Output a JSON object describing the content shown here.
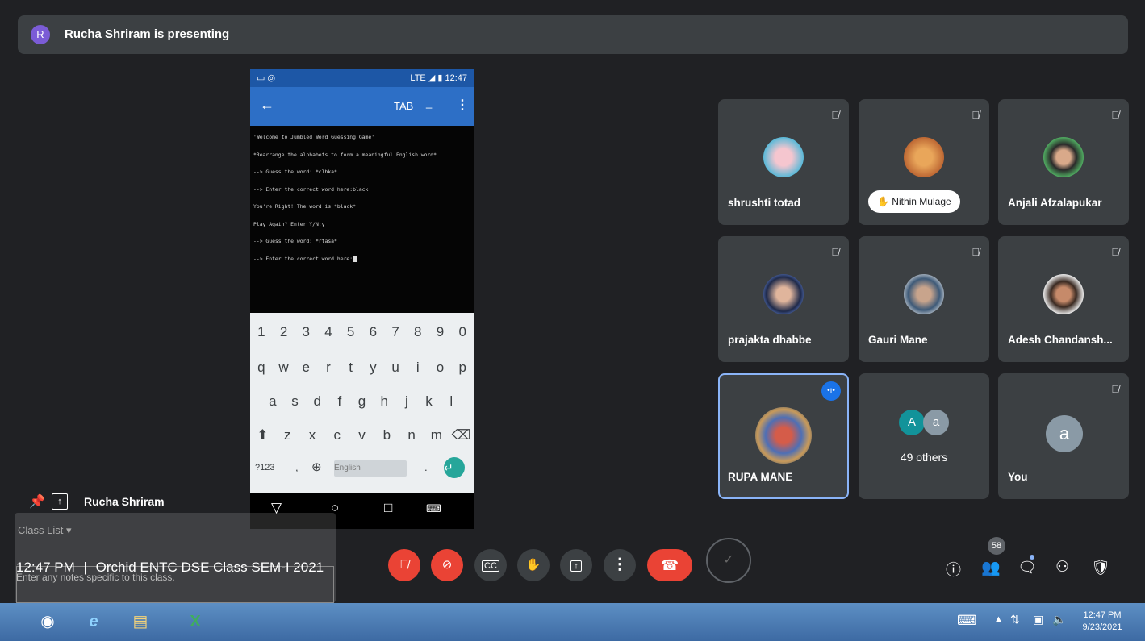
{
  "banner": {
    "avatar_letter": "R",
    "text": "Rucha Shriram is presenting"
  },
  "phone": {
    "status_time": "12:47",
    "status_network": "LTE",
    "appbar_title": "TAB",
    "terminal_lines": [
      "'Welcome to Jumbled Word Guessing Game'",
      "*Rearrange the alphabets to form a meaningful English word*",
      "--> Guess the word: *clbka*",
      "--> Enter the correct word here:black",
      "You're Right! The word is *black*",
      "Play Again? Enter Y/N:y",
      "--> Guess the word: *rtasa*",
      "--> Enter the correct word here:"
    ],
    "keyboard": {
      "row1": [
        "1",
        "2",
        "3",
        "4",
        "5",
        "6",
        "7",
        "8",
        "9",
        "0"
      ],
      "row2": [
        "q",
        "w",
        "e",
        "r",
        "t",
        "y",
        "u",
        "i",
        "o",
        "p"
      ],
      "row3": [
        "a",
        "s",
        "d",
        "f",
        "g",
        "h",
        "j",
        "k",
        "l"
      ],
      "row4": [
        "z",
        "x",
        "c",
        "v",
        "b",
        "n",
        "m"
      ],
      "sym_key": "?123",
      "comma": ",",
      "period": ".",
      "space_label": "English"
    }
  },
  "participants": [
    {
      "name": "shrushti totad",
      "muted": true
    },
    {
      "name": "Nithin Mulage",
      "muted": true,
      "hand_raised": true
    },
    {
      "name": "Anjali Afzalapukar",
      "muted": true
    },
    {
      "name": "prajakta dhabbe",
      "muted": true
    },
    {
      "name": "Gauri Mane",
      "muted": true
    },
    {
      "name": "Adesh Chandansh...",
      "muted": true
    },
    {
      "name": "RUPA MANE",
      "speaking": true
    },
    {
      "name": "49 others",
      "avatars": [
        "A",
        "a"
      ]
    },
    {
      "name": "You",
      "avatar_letter": "a",
      "muted": true
    }
  ],
  "presenter_label": "Rucha Shriram",
  "overlay": {
    "class_list_label": "Class List",
    "notes_placeholder": "Enter any notes specific to this class."
  },
  "meeting": {
    "time": "12:47 PM",
    "separator": "|",
    "title": "Orchid ENTC DSE Class SEM-I 2021"
  },
  "people_count": "58",
  "taskbar": {
    "clock_time": "12:47 PM",
    "clock_date": "9/23/2021"
  },
  "colors": {
    "bg": "#202124",
    "tile": "#3c4043",
    "red": "#ea4335",
    "accent": "#8ab4f8",
    "phone_bar": "#2d6fc6"
  }
}
